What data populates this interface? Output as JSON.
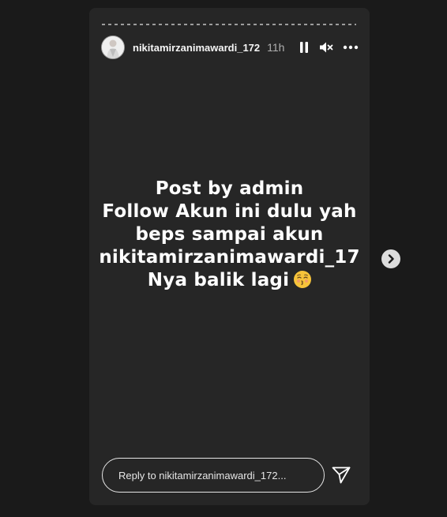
{
  "story": {
    "username": "nikitamirzanimawardi_172",
    "time": "11h",
    "caption_lines": [
      "Post by admin",
      "Follow Akun ini dulu yah",
      "beps sampai akun",
      "nikitamirzanimawardi_17",
      "Nya balik lagi"
    ],
    "caption_emoji": "kissing-face-closed-eyes",
    "reply_placeholder": "Reply to nikitamirzanimawardi_172...",
    "icons": {
      "pause": "pause-icon",
      "mute": "speaker-muted-icon",
      "more": "more-options-icon",
      "send": "send-icon",
      "next": "chevron-right-icon"
    }
  }
}
